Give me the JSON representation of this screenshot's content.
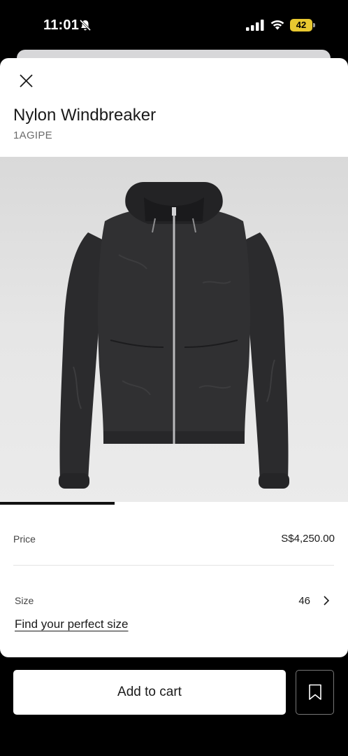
{
  "status_bar": {
    "time": "11:01",
    "battery": "42",
    "battery_color": "#e8c830"
  },
  "product": {
    "title": "Nylon Windbreaker",
    "sku": "1AGIPE"
  },
  "gallery": {
    "progress_fraction": 0.33
  },
  "price": {
    "label": "Price",
    "value": "S$4,250.00"
  },
  "size": {
    "label": "Size",
    "value": "46",
    "link": "Find your perfect size"
  },
  "actions": {
    "add_to_cart": "Add to cart"
  },
  "icons": [
    "bell-slash-icon",
    "signal-icon",
    "wifi-icon",
    "battery-icon",
    "close-icon",
    "chevron-right-icon",
    "bookmark-icon"
  ]
}
